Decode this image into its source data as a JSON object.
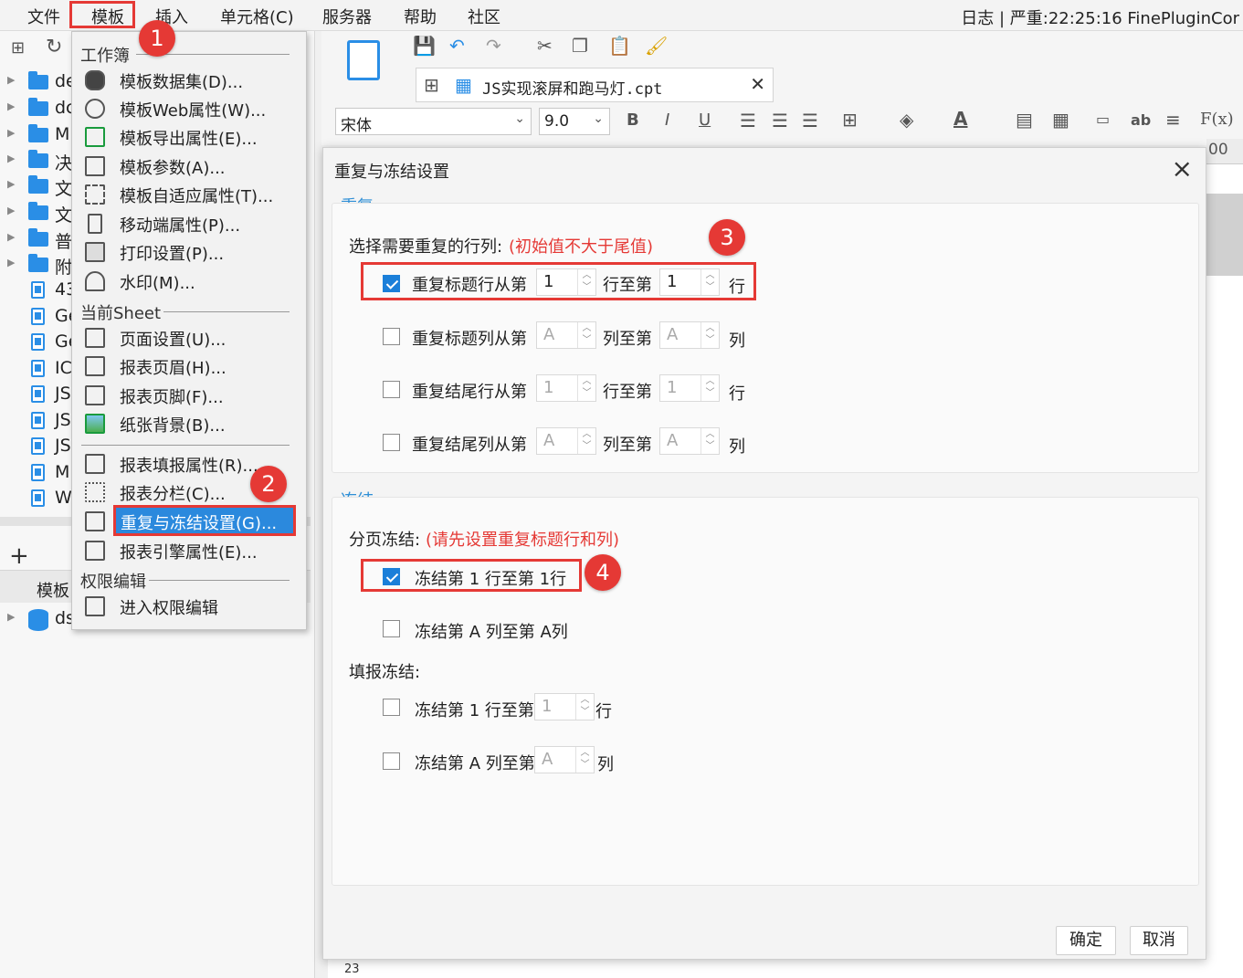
{
  "menubar": {
    "items": [
      "文件",
      "模板",
      "插入",
      "单元格(C)",
      "服务器",
      "帮助",
      "社区"
    ],
    "status": "日志 | 严重:22:25:16 FinePluginCor"
  },
  "tree": {
    "items": [
      "de",
      "dc",
      "M",
      "决",
      "文",
      "文",
      "普",
      "附",
      "43",
      "Ge",
      "Ge",
      "IC",
      "JS",
      "JS",
      "JS",
      "M",
      "W"
    ],
    "bottom_tab": "模板",
    "ds": "ds"
  },
  "editor": {
    "tab_title": "JS实现滚屏和跑马灯.cpt",
    "font_name": "宋体",
    "font_size": "9.0",
    "row_number": "23",
    "ruler_fragment": "00"
  },
  "menu": {
    "section_workbook": "工作簿",
    "workbook_items": [
      "模板数据集(D)...",
      "模板Web属性(W)...",
      "模板导出属性(E)...",
      "模板参数(A)...",
      "模板自适应属性(T)...",
      "移动端属性(P)...",
      "打印设置(P)...",
      "水印(M)..."
    ],
    "section_sheet": "当前Sheet",
    "sheet_items": [
      "页面设置(U)...",
      "报表页眉(H)...",
      "报表页脚(F)...",
      "纸张背景(B)..."
    ],
    "sheet_items2": [
      "报表填报属性(R)...",
      "报表分栏(C)...",
      "重复与冻结设置(G)...",
      "报表引擎属性(E)..."
    ],
    "section_perm": "权限编辑",
    "perm_items": [
      "进入权限编辑"
    ]
  },
  "dialog": {
    "title": "重复与冻结设置",
    "repeat": {
      "title": "重复",
      "prompt": "选择需要重复的行列:",
      "hint": "(初始值不大于尾值)",
      "rows": [
        {
          "label": "重复标题行从第",
          "from": "1",
          "mid": "行至第",
          "to": "1",
          "unit": "行",
          "checked": true
        },
        {
          "label": "重复标题列从第",
          "from": "A",
          "mid": "列至第",
          "to": "A",
          "unit": "列",
          "checked": false
        },
        {
          "label": "重复结尾行从第",
          "from": "1",
          "mid": "行至第",
          "to": "1",
          "unit": "行",
          "checked": false
        },
        {
          "label": "重复结尾列从第",
          "from": "A",
          "mid": "列至第",
          "to": "A",
          "unit": "列",
          "checked": false
        }
      ]
    },
    "freeze": {
      "title": "冻结",
      "page_label": "分页冻结:",
      "page_hint": "(请先设置重复标题行和列)",
      "page_row": "冻结第 1 行至第  1行",
      "page_col": "冻结第 A 列至第  A列",
      "fill_label": "填报冻结:",
      "fill_row_label": "冻结第 1 行至第",
      "fill_row_value": "1",
      "fill_row_unit": "行",
      "fill_col_label": "冻结第 A 列至第",
      "fill_col_value": "A",
      "fill_col_unit": "列"
    },
    "ok": "确定",
    "cancel": "取消"
  },
  "annotations": [
    "1",
    "2",
    "3",
    "4"
  ],
  "colors": {
    "accent": "#1b7fd9",
    "highlight": "#e53935",
    "group_title": "#2f8fd6"
  }
}
